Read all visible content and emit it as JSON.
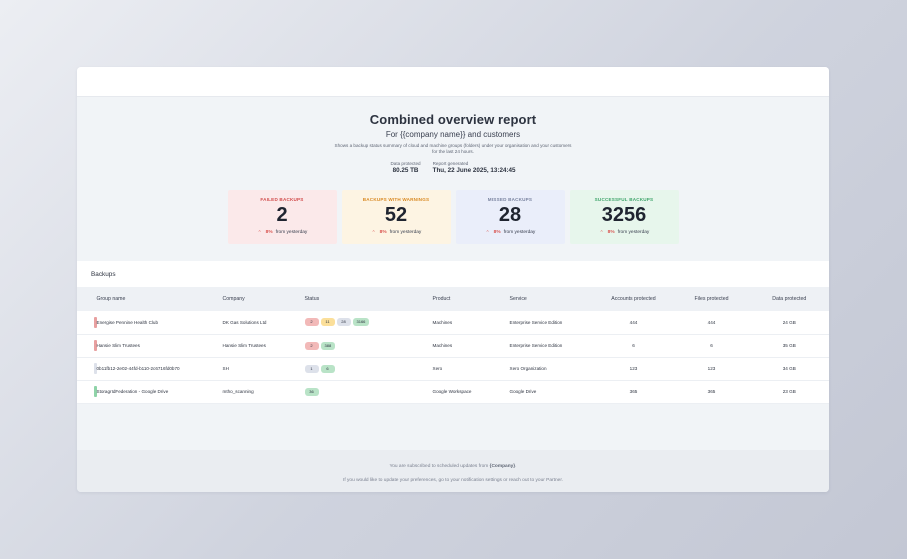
{
  "report": {
    "title": "Combined overview report",
    "subtitle": "For {{company name}} and customers",
    "description": "Shows a backup status summary of cloud and machine groups (folders) under your organisation and your customers for the last 24 hours.",
    "data_protected_label": "Data protected",
    "data_protected_value": "80.25 TB",
    "generated_label": "Report generated",
    "generated_value": "Thu, 22 June 2025, 13:24:45"
  },
  "stats": [
    {
      "label": "FAILED BACKUPS",
      "value": "2",
      "pct": "8%",
      "suffix": "from yesterday"
    },
    {
      "label": "BACKUPS WITH WARNINGS",
      "value": "52",
      "pct": "8%",
      "suffix": "from yesterday"
    },
    {
      "label": "MISSED BACKUPS",
      "value": "28",
      "pct": "8%",
      "suffix": "from yesterday"
    },
    {
      "label": "SUCCESSFUL BACKUPS",
      "value": "3256",
      "pct": "8%",
      "suffix": "from yesterday"
    }
  ],
  "backups": {
    "title": "Backups",
    "columns": [
      "Group name",
      "Company",
      "Status",
      "Product",
      "Service",
      "Accounts protected",
      "Files protected",
      "Data protected"
    ],
    "rows": [
      {
        "bar_color": "#e8a0a0",
        "group": "Energise Pennine Health Club",
        "company": "DK Gas Solutions Ltd",
        "statuses": [
          {
            "v": "2",
            "c": "red"
          },
          {
            "v": "11",
            "c": "yellow"
          },
          {
            "v": "28",
            "c": "grey"
          },
          {
            "v": "3166",
            "c": "green"
          }
        ],
        "product": "Machines",
        "service": "Enterprise Service Edition",
        "accounts": "444",
        "files": "444",
        "data": "24 GB"
      },
      {
        "bar_color": "#e8a0a0",
        "group": "Hansie Slim Trustees",
        "company": "Hansie Slim Trustees",
        "statuses": [
          {
            "v": "2",
            "c": "red"
          },
          {
            "v": "388",
            "c": "green"
          }
        ],
        "product": "Machines",
        "service": "Enterprise Service Edition",
        "accounts": "6",
        "files": "6",
        "data": "35 GB"
      },
      {
        "bar_color": "#dde1ea",
        "group": "0b11fb12-2e02-44fd-b110-2c6716fd0b70",
        "company": "SH",
        "statuses": [
          {
            "v": "1",
            "c": "grey"
          },
          {
            "v": "6",
            "c": "green"
          }
        ],
        "product": "Xero",
        "service": "Xero Organization",
        "accounts": "123",
        "files": "123",
        "data": "34 GB"
      },
      {
        "bar_color": "#8fd3a8",
        "group": "StoragrIdFederation - Google Drive",
        "company": "mtho_scanning",
        "statuses": [
          {
            "v": "36",
            "c": "green"
          }
        ],
        "product": "Google Workspace",
        "service": "Google Drive",
        "accounts": "365",
        "files": "365",
        "data": "23 GB"
      }
    ]
  },
  "footer": {
    "line1_prefix": "You are subscribed to scheduled updates from ",
    "line1_company": "{Company}",
    "line1_suffix": ".",
    "line2": "If you would like to update your preferences, go to your notification settings or reach out to your Partner."
  }
}
